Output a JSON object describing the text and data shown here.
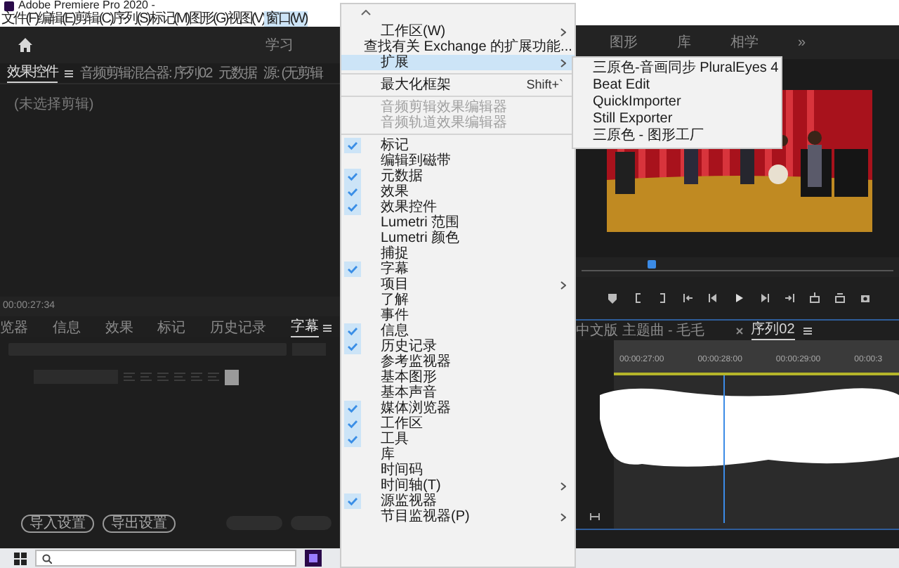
{
  "window": {
    "title": "Adobe Premiere Pro 2020 -"
  },
  "menu_bar": [
    {
      "label": "文件(F)",
      "selected": false
    },
    {
      "label": "编辑(E)",
      "selected": false
    },
    {
      "label": "剪辑(C)",
      "selected": false
    },
    {
      "label": "序列(S)",
      "selected": false
    },
    {
      "label": "标记(M)",
      "selected": false
    },
    {
      "label": "图形(G)",
      "selected": false
    },
    {
      "label": "视图(V)",
      "selected": false
    },
    {
      "label": "窗口(W)",
      "selected": true
    }
  ],
  "left_workspaces": [
    "学习"
  ],
  "right_workspaces": [
    "图形",
    "库",
    "相学",
    "»"
  ],
  "effects_panel": {
    "tabs": [
      {
        "label": "效果控件",
        "selected": true
      },
      {
        "label": "音频剪辑混合器: 序列02",
        "selected": false
      },
      {
        "label": "元数据",
        "selected": false
      },
      {
        "label": "源: (无剪辑",
        "selected": false
      }
    ],
    "message": "(未选择剪辑)",
    "timecode": "00:00:27:34"
  },
  "captions_panel": {
    "tabs": [
      {
        "label": "览器",
        "selected": false
      },
      {
        "label": "信息",
        "selected": false
      },
      {
        "label": "效果",
        "selected": false
      },
      {
        "label": "标记",
        "selected": false
      },
      {
        "label": "历史记录",
        "selected": false
      },
      {
        "label": "字幕",
        "selected": true
      }
    ],
    "buttons": [
      "导入设置",
      "导出设置"
    ]
  },
  "window_menu": {
    "sections": [
      [
        {
          "label": "工作区(W)",
          "checked": false,
          "disabled": false,
          "submenu": true,
          "selected": false
        },
        {
          "label": "查找有关 Exchange 的扩展功能...",
          "checked": false,
          "disabled": false,
          "submenu": false,
          "selected": false
        },
        {
          "label": "扩展",
          "checked": false,
          "disabled": false,
          "submenu": true,
          "selected": true
        }
      ],
      [
        {
          "label": "最大化框架",
          "shortcut": "Shift+`",
          "checked": false,
          "disabled": false,
          "submenu": false,
          "selected": false
        }
      ],
      [
        {
          "label": "音频剪辑效果编辑器",
          "checked": false,
          "disabled": true,
          "submenu": false,
          "selected": false
        },
        {
          "label": "音频轨道效果编辑器",
          "checked": false,
          "disabled": true,
          "submenu": false,
          "selected": false
        }
      ],
      [
        {
          "label": "标记",
          "checked": true,
          "disabled": false,
          "submenu": false,
          "selected": false
        },
        {
          "label": "编辑到磁带",
          "checked": false,
          "disabled": false,
          "submenu": false,
          "selected": false
        },
        {
          "label": "元数据",
          "checked": true,
          "disabled": false,
          "submenu": false,
          "selected": false
        },
        {
          "label": "效果",
          "checked": true,
          "disabled": false,
          "submenu": false,
          "selected": false
        },
        {
          "label": "效果控件",
          "checked": true,
          "disabled": false,
          "submenu": false,
          "selected": false
        },
        {
          "label": "Lumetri 范围",
          "checked": false,
          "disabled": false,
          "submenu": false,
          "selected": false
        },
        {
          "label": "Lumetri 颜色",
          "checked": false,
          "disabled": false,
          "submenu": false,
          "selected": false
        },
        {
          "label": "捕捉",
          "checked": false,
          "disabled": false,
          "submenu": false,
          "selected": false
        },
        {
          "label": "字幕",
          "checked": true,
          "disabled": false,
          "submenu": false,
          "selected": false
        },
        {
          "label": "项目",
          "checked": false,
          "disabled": false,
          "submenu": true,
          "selected": false
        },
        {
          "label": "了解",
          "checked": false,
          "disabled": false,
          "submenu": false,
          "selected": false
        },
        {
          "label": "事件",
          "checked": false,
          "disabled": false,
          "submenu": false,
          "selected": false
        },
        {
          "label": "信息",
          "checked": true,
          "disabled": false,
          "submenu": false,
          "selected": false
        },
        {
          "label": "历史记录",
          "checked": true,
          "disabled": false,
          "submenu": false,
          "selected": false
        },
        {
          "label": "参考监视器",
          "checked": false,
          "disabled": false,
          "submenu": false,
          "selected": false
        },
        {
          "label": "基本图形",
          "checked": false,
          "disabled": false,
          "submenu": false,
          "selected": false
        },
        {
          "label": "基本声音",
          "checked": false,
          "disabled": false,
          "submenu": false,
          "selected": false
        },
        {
          "label": "媒体浏览器",
          "checked": true,
          "disabled": false,
          "submenu": false,
          "selected": false
        },
        {
          "label": "工作区",
          "checked": true,
          "disabled": false,
          "submenu": false,
          "selected": false
        },
        {
          "label": "工具",
          "checked": true,
          "disabled": false,
          "submenu": false,
          "selected": false
        },
        {
          "label": "库",
          "checked": false,
          "disabled": false,
          "submenu": false,
          "selected": false
        },
        {
          "label": "时间码",
          "checked": false,
          "disabled": false,
          "submenu": false,
          "selected": false
        },
        {
          "label": "时间轴(T)",
          "checked": false,
          "disabled": false,
          "submenu": true,
          "selected": false
        },
        {
          "label": "源监视器",
          "checked": true,
          "disabled": false,
          "submenu": false,
          "selected": false
        },
        {
          "label": "节目监视器(P)",
          "checked": false,
          "disabled": false,
          "submenu": true,
          "selected": false
        }
      ]
    ]
  },
  "extensions_submenu": [
    "三原色-音画同步 PluralEyes 4",
    "Beat Edit",
    "QuickImporter",
    "Still Exporter",
    "三原色 - 图形工厂"
  ],
  "program_monitor": {
    "picture": {
      "kind": "picture"
    }
  },
  "timeline": {
    "tabs": [
      {
        "label": "中文版 主题曲 - 毛毛",
        "selected": false,
        "closable": false
      },
      {
        "label": "序列02",
        "selected": true,
        "closable": true
      }
    ],
    "timecodes": [
      "00:00:27:00",
      "00:00:28:00",
      "00:00:29:00",
      "00:00:3"
    ]
  }
}
